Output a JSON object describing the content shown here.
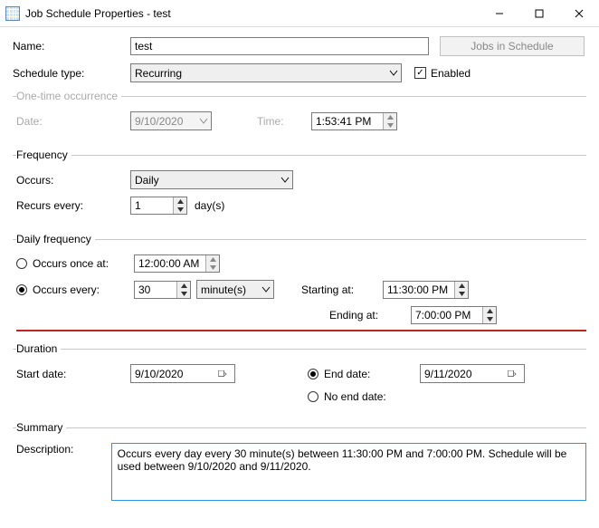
{
  "window": {
    "title": "Job Schedule Properties - test",
    "jobs_button": "Jobs in Schedule"
  },
  "name": {
    "label": "Name:",
    "value": "test"
  },
  "schedule_type": {
    "label": "Schedule type:",
    "value": "Recurring"
  },
  "enabled": {
    "label": "Enabled",
    "checked": true
  },
  "onetime": {
    "legend": "One-time occurrence",
    "date_label": "Date:",
    "date_value": "9/10/2020",
    "time_label": "Time:",
    "time_value": "1:53:41 PM"
  },
  "frequency": {
    "legend": "Frequency",
    "occurs_label": "Occurs:",
    "occurs_value": "Daily",
    "recurs_label": "Recurs every:",
    "recurs_value": "1",
    "recurs_unit": "day(s)"
  },
  "daily": {
    "legend": "Daily frequency",
    "once_label": "Occurs once at:",
    "once_value": "12:00:00 AM",
    "every_label": "Occurs every:",
    "every_value": "30",
    "every_unit": "minute(s)",
    "starting_label": "Starting at:",
    "starting_value": "11:30:00 PM",
    "ending_label": "Ending at:",
    "ending_value": "7:00:00 PM"
  },
  "duration": {
    "legend": "Duration",
    "start_label": "Start date:",
    "start_value": "9/10/2020",
    "end_label": "End date:",
    "end_value": "9/11/2020",
    "noend_label": "No end date:"
  },
  "summary": {
    "legend": "Summary",
    "desc_label": "Description:",
    "desc_value": "Occurs every day every 30 minute(s) between 11:30:00 PM and 7:00:00 PM. Schedule will be used between 9/10/2020 and 9/11/2020."
  }
}
